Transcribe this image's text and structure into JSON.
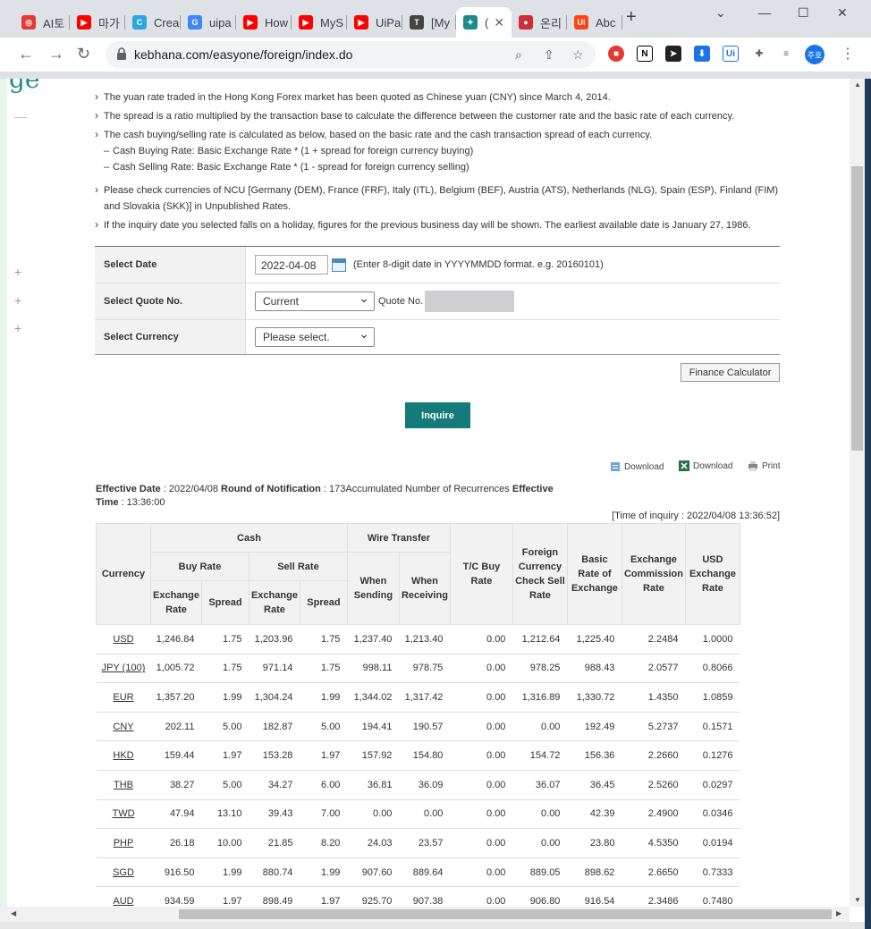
{
  "browser": {
    "tabs": [
      {
        "label": "AI토",
        "color": "#e53935",
        "glyph": "◎"
      },
      {
        "label": "마가",
        "color": "#ff0000",
        "glyph": "▶"
      },
      {
        "label": "Crea",
        "color": "#29a8e0",
        "glyph": "C"
      },
      {
        "label": "uipa",
        "color": "#4285f4",
        "glyph": "G"
      },
      {
        "label": "How",
        "color": "#ff0000",
        "glyph": "▶"
      },
      {
        "label": "MyS",
        "color": "#ff0000",
        "glyph": "▶"
      },
      {
        "label": "UiPa",
        "color": "#ff0000",
        "glyph": "▶"
      },
      {
        "label": "[My",
        "color": "#444444",
        "glyph": "T"
      },
      {
        "label": "(",
        "color": "#1d8b8b",
        "glyph": "✦"
      },
      {
        "label": "온리",
        "color": "#cd2e3a",
        "glyph": "●"
      },
      {
        "label": "Abc",
        "color": "#fa4616",
        "glyph": "Ui"
      }
    ],
    "url": "kebhana.com/easyone/foreign/index.do",
    "profile_label": "주호"
  },
  "sidebar": {
    "logo_text": "ge"
  },
  "notes": [
    "The yuan rate traded in the Hong Kong Forex market has been quoted as Chinese yuan (CNY) since March 4, 2014.",
    "The spread is a ratio multiplied by the transaction base to calculate the difference between the customer rate and the basic rate of each currency.",
    "The cash buying/selling rate is calculated as below, based on the basic rate and the cash transaction spread of each currency."
  ],
  "subnotes": [
    "Cash Buying Rate: Basic Exchange Rate * (1 + spread for foreign currency buying)",
    "Cash Selling Rate: Basic Exchange Rate * (1 - spread for foreign currency selling)"
  ],
  "notes2": [
    "Please check currencies of NCU [Germany (DEM), France (FRF), Italy (ITL), Belgium (BEF), Austria (ATS), Netherlands (NLG), Spain (ESP), Finland (FIM) and Slovakia (SKK)] in Unpublished Rates.",
    "If the inquiry date you selected falls on a holiday, figures for the previous business day will be shown. The earliest available date is January 27, 1986."
  ],
  "form": {
    "date_label": "Select Date",
    "date_value": "2022-04-08",
    "date_hint": "(Enter 8-digit date in YYYYMMDD format. e.g. 20160101)",
    "quote_label": "Select Quote No.",
    "quote_value": "Current",
    "quote_no_label": "Quote No.",
    "currency_label": "Select Currency",
    "currency_value": "Please select."
  },
  "buttons": {
    "finance_calc": "Finance Calculator",
    "inquire": "Inquire",
    "download1": "Download",
    "download2": "Download",
    "print": "Print"
  },
  "effective": {
    "eff_label": "Effective Date",
    "eff_value": " : 2022/04/08 ",
    "round_label": "Round of Notification",
    "round_value": " : 173Accumulated Number of Recurrences ",
    "eff2_label": "Effective",
    "time_label": "Time",
    "time_value": " : 13:36:00",
    "inquiry_time": "[Time of inquiry : 2022/04/08 13:36:52]"
  },
  "table": {
    "h_currency": "Currency",
    "h_cash": "Cash",
    "h_wire": "Wire Transfer",
    "h_tc": "T/C Buy Rate",
    "h_fccs": "Foreign Currency Check Sell Rate",
    "h_basic": "Basic Rate of Exchange",
    "h_comm": "Exchange Commission Rate",
    "h_usd": "USD Exchange Rate",
    "h_buy": "Buy Rate",
    "h_sell": "Sell Rate",
    "h_sending": "When Sending",
    "h_receiving": "When Receiving",
    "h_exrate": "Exchange Rate",
    "h_spread": "Spread",
    "rows": [
      [
        "USD",
        "1,246.84",
        "1.75",
        "1,203.96",
        "1.75",
        "1,237.40",
        "1,213.40",
        "0.00",
        "1,212.64",
        "1,225.40",
        "2.2484",
        "1.0000"
      ],
      [
        "JPY (100)",
        "1,005.72",
        "1.75",
        "971.14",
        "1.75",
        "998.11",
        "978.75",
        "0.00",
        "978.25",
        "988.43",
        "2.0577",
        "0.8066"
      ],
      [
        "EUR",
        "1,357.20",
        "1.99",
        "1,304.24",
        "1.99",
        "1,344.02",
        "1,317.42",
        "0.00",
        "1,316.89",
        "1,330.72",
        "1.4350",
        "1.0859"
      ],
      [
        "CNY",
        "202.11",
        "5.00",
        "182.87",
        "5.00",
        "194.41",
        "190.57",
        "0.00",
        "0.00",
        "192.49",
        "5.2737",
        "0.1571"
      ],
      [
        "HKD",
        "159.44",
        "1.97",
        "153.28",
        "1.97",
        "157.92",
        "154.80",
        "0.00",
        "154.72",
        "156.36",
        "2.2660",
        "0.1276"
      ],
      [
        "THB",
        "38.27",
        "5.00",
        "34.27",
        "6.00",
        "36.81",
        "36.09",
        "0.00",
        "36.07",
        "36.45",
        "2.5260",
        "0.0297"
      ],
      [
        "TWD",
        "47.94",
        "13.10",
        "39.43",
        "7.00",
        "0.00",
        "0.00",
        "0.00",
        "0.00",
        "42.39",
        "2.4900",
        "0.0346"
      ],
      [
        "PHP",
        "26.18",
        "10.00",
        "21.85",
        "8.20",
        "24.03",
        "23.57",
        "0.00",
        "0.00",
        "23.80",
        "4.5350",
        "0.0194"
      ],
      [
        "SGD",
        "916.50",
        "1.99",
        "880.74",
        "1.99",
        "907.60",
        "889.64",
        "0.00",
        "889.05",
        "898.62",
        "2.6650",
        "0.7333"
      ],
      [
        "AUD",
        "934.59",
        "1.97",
        "898.49",
        "1.97",
        "925.70",
        "907.38",
        "0.00",
        "906.80",
        "916.54",
        "2.3486",
        "0.7480"
      ]
    ]
  }
}
